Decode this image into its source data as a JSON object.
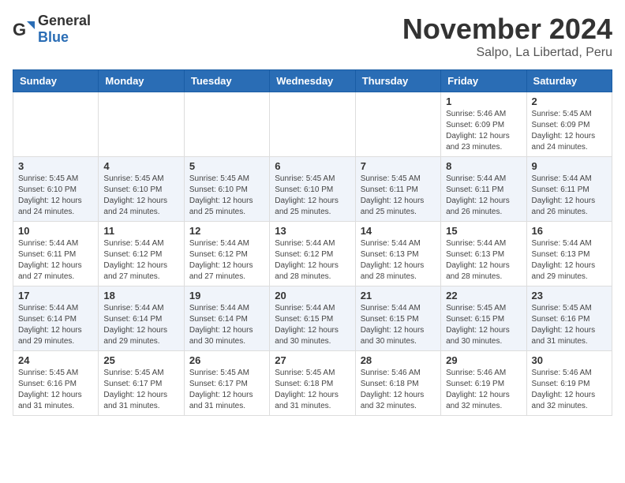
{
  "logo": {
    "general": "General",
    "blue": "Blue"
  },
  "header": {
    "month": "November 2024",
    "location": "Salpo, La Libertad, Peru"
  },
  "weekdays": [
    "Sunday",
    "Monday",
    "Tuesday",
    "Wednesday",
    "Thursday",
    "Friday",
    "Saturday"
  ],
  "weeks": [
    [
      {
        "day": "",
        "info": ""
      },
      {
        "day": "",
        "info": ""
      },
      {
        "day": "",
        "info": ""
      },
      {
        "day": "",
        "info": ""
      },
      {
        "day": "",
        "info": ""
      },
      {
        "day": "1",
        "info": "Sunrise: 5:46 AM\nSunset: 6:09 PM\nDaylight: 12 hours and 23 minutes."
      },
      {
        "day": "2",
        "info": "Sunrise: 5:45 AM\nSunset: 6:09 PM\nDaylight: 12 hours and 24 minutes."
      }
    ],
    [
      {
        "day": "3",
        "info": "Sunrise: 5:45 AM\nSunset: 6:10 PM\nDaylight: 12 hours and 24 minutes."
      },
      {
        "day": "4",
        "info": "Sunrise: 5:45 AM\nSunset: 6:10 PM\nDaylight: 12 hours and 24 minutes."
      },
      {
        "day": "5",
        "info": "Sunrise: 5:45 AM\nSunset: 6:10 PM\nDaylight: 12 hours and 25 minutes."
      },
      {
        "day": "6",
        "info": "Sunrise: 5:45 AM\nSunset: 6:10 PM\nDaylight: 12 hours and 25 minutes."
      },
      {
        "day": "7",
        "info": "Sunrise: 5:45 AM\nSunset: 6:11 PM\nDaylight: 12 hours and 25 minutes."
      },
      {
        "day": "8",
        "info": "Sunrise: 5:44 AM\nSunset: 6:11 PM\nDaylight: 12 hours and 26 minutes."
      },
      {
        "day": "9",
        "info": "Sunrise: 5:44 AM\nSunset: 6:11 PM\nDaylight: 12 hours and 26 minutes."
      }
    ],
    [
      {
        "day": "10",
        "info": "Sunrise: 5:44 AM\nSunset: 6:11 PM\nDaylight: 12 hours and 27 minutes."
      },
      {
        "day": "11",
        "info": "Sunrise: 5:44 AM\nSunset: 6:12 PM\nDaylight: 12 hours and 27 minutes."
      },
      {
        "day": "12",
        "info": "Sunrise: 5:44 AM\nSunset: 6:12 PM\nDaylight: 12 hours and 27 minutes."
      },
      {
        "day": "13",
        "info": "Sunrise: 5:44 AM\nSunset: 6:12 PM\nDaylight: 12 hours and 28 minutes."
      },
      {
        "day": "14",
        "info": "Sunrise: 5:44 AM\nSunset: 6:13 PM\nDaylight: 12 hours and 28 minutes."
      },
      {
        "day": "15",
        "info": "Sunrise: 5:44 AM\nSunset: 6:13 PM\nDaylight: 12 hours and 28 minutes."
      },
      {
        "day": "16",
        "info": "Sunrise: 5:44 AM\nSunset: 6:13 PM\nDaylight: 12 hours and 29 minutes."
      }
    ],
    [
      {
        "day": "17",
        "info": "Sunrise: 5:44 AM\nSunset: 6:14 PM\nDaylight: 12 hours and 29 minutes."
      },
      {
        "day": "18",
        "info": "Sunrise: 5:44 AM\nSunset: 6:14 PM\nDaylight: 12 hours and 29 minutes."
      },
      {
        "day": "19",
        "info": "Sunrise: 5:44 AM\nSunset: 6:14 PM\nDaylight: 12 hours and 30 minutes."
      },
      {
        "day": "20",
        "info": "Sunrise: 5:44 AM\nSunset: 6:15 PM\nDaylight: 12 hours and 30 minutes."
      },
      {
        "day": "21",
        "info": "Sunrise: 5:44 AM\nSunset: 6:15 PM\nDaylight: 12 hours and 30 minutes."
      },
      {
        "day": "22",
        "info": "Sunrise: 5:45 AM\nSunset: 6:15 PM\nDaylight: 12 hours and 30 minutes."
      },
      {
        "day": "23",
        "info": "Sunrise: 5:45 AM\nSunset: 6:16 PM\nDaylight: 12 hours and 31 minutes."
      }
    ],
    [
      {
        "day": "24",
        "info": "Sunrise: 5:45 AM\nSunset: 6:16 PM\nDaylight: 12 hours and 31 minutes."
      },
      {
        "day": "25",
        "info": "Sunrise: 5:45 AM\nSunset: 6:17 PM\nDaylight: 12 hours and 31 minutes."
      },
      {
        "day": "26",
        "info": "Sunrise: 5:45 AM\nSunset: 6:17 PM\nDaylight: 12 hours and 31 minutes."
      },
      {
        "day": "27",
        "info": "Sunrise: 5:45 AM\nSunset: 6:18 PM\nDaylight: 12 hours and 31 minutes."
      },
      {
        "day": "28",
        "info": "Sunrise: 5:46 AM\nSunset: 6:18 PM\nDaylight: 12 hours and 32 minutes."
      },
      {
        "day": "29",
        "info": "Sunrise: 5:46 AM\nSunset: 6:19 PM\nDaylight: 12 hours and 32 minutes."
      },
      {
        "day": "30",
        "info": "Sunrise: 5:46 AM\nSunset: 6:19 PM\nDaylight: 12 hours and 32 minutes."
      }
    ]
  ]
}
